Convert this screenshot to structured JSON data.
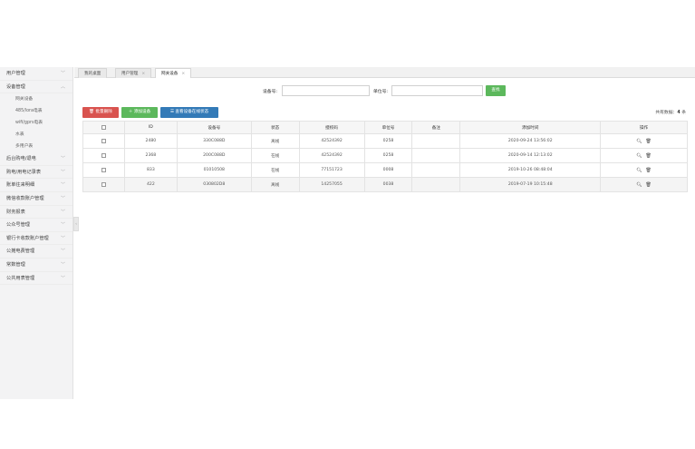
{
  "sidebar": {
    "items": [
      {
        "label": "用户管理"
      },
      {
        "label": "设备管理",
        "expanded": true,
        "sub": [
          {
            "label": "网关设备"
          },
          {
            "label": "485/lora电表"
          },
          {
            "label": "wifi/gprs电表"
          },
          {
            "label": "水表"
          },
          {
            "label": "多用户表"
          }
        ]
      },
      {
        "label": "后台购电/退电"
      },
      {
        "label": "购电/用电记录表"
      },
      {
        "label": "账单往来明细"
      },
      {
        "label": "微信收款账户管理"
      },
      {
        "label": "财务报表"
      },
      {
        "label": "公众号管理"
      },
      {
        "label": "银行卡收款账户管理"
      },
      {
        "label": "公摊电费管理"
      },
      {
        "label": "常数管理"
      },
      {
        "label": "公共用表管理"
      }
    ]
  },
  "tabs": [
    {
      "label": "我的桌面"
    },
    {
      "label": "用户管理",
      "close": "×"
    },
    {
      "label": "网关设备",
      "close": "×"
    }
  ],
  "search": {
    "device_label": "设备号:",
    "device_value": "",
    "unit_label": "单位号:",
    "unit_value": "",
    "search_button": "查找"
  },
  "toolbar": {
    "batch_delete": "批量删除",
    "add_device": "添加设备",
    "view_status": "查看设备在线状态",
    "total_label": "共有数据：",
    "total_value": "4",
    "total_unit": " 条"
  },
  "table": {
    "headers": [
      "",
      "ID",
      "设备号",
      "状态",
      "授权码",
      "单位号",
      "备注",
      "添加时间",
      "操作"
    ],
    "rows": [
      {
        "id": "2480",
        "device": "330C088D",
        "status": "离线",
        "auth": "42524392",
        "unit": "0258",
        "remark": "",
        "time": "2020-09-24 13:56:02"
      },
      {
        "id": "2368",
        "device": "200C088D",
        "status": "在线",
        "auth": "42524392",
        "unit": "0258",
        "remark": "",
        "time": "2020-09-14 12:13:02"
      },
      {
        "id": "833",
        "device": "01010508",
        "status": "在线",
        "auth": "77151723",
        "unit": "0008",
        "remark": "",
        "time": "2019-10-26 08:48:04"
      },
      {
        "id": "422",
        "device": "030802D8",
        "status": "离线",
        "auth": "14257055",
        "unit": "0038",
        "remark": "",
        "time": "2019-07-19 10:15:48"
      }
    ]
  },
  "icons": {
    "search": "search-icon",
    "delete": "trash-icon",
    "chevron": "chevron-icon"
  }
}
